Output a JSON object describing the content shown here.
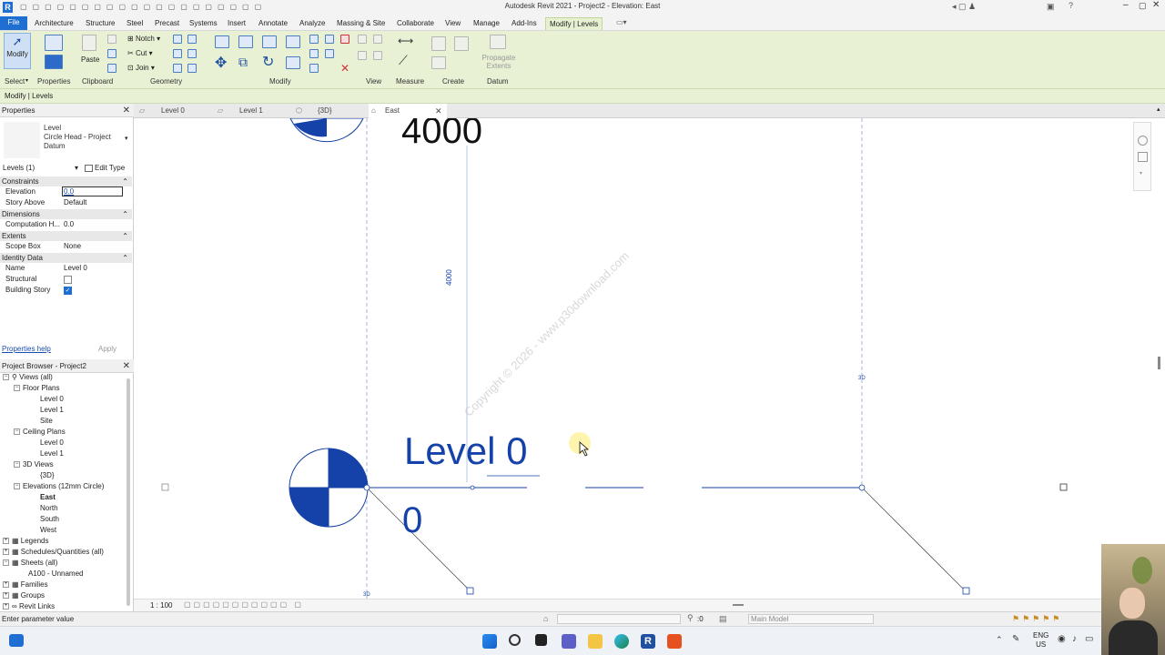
{
  "app": {
    "title": "Autodesk Revit 2021 - Project2 - Elevation: East"
  },
  "ribbon_tabs": [
    "File",
    "Architecture",
    "Structure",
    "Steel",
    "Precast",
    "Systems",
    "Insert",
    "Annotate",
    "Analyze",
    "Massing & Site",
    "Collaborate",
    "View",
    "Manage",
    "Add-Ins",
    "Modify | Levels"
  ],
  "ribbon": {
    "modify_label": "Modify",
    "paste_label": "Paste",
    "notch_label": "Notch",
    "cut_label": "Cut",
    "join_label": "Join",
    "propagate_label": "Propagate Extents",
    "groups": {
      "select": "Select",
      "properties": "Properties",
      "clipboard": "Clipboard",
      "geometry": "Geometry",
      "modify": "Modify",
      "view": "View",
      "measure": "Measure",
      "create": "Create",
      "datum": "Datum"
    }
  },
  "context_bar": "Modify | Levels",
  "properties": {
    "title": "Properties",
    "type_family": "Level",
    "type_name": "Circle Head - Project Datum",
    "selector": "Levels (1)",
    "edit_type": "Edit Type",
    "sections": {
      "constraints": "Constraints",
      "dimensions": "Dimensions",
      "extents": "Extents",
      "identity": "Identity Data"
    },
    "rows": {
      "elevation_label": "Elevation",
      "elevation_value": "0.0",
      "story_above_label": "Story Above",
      "story_above_value": "Default",
      "computation_label": "Computation H...",
      "computation_value": "0.0",
      "scope_box_label": "Scope Box",
      "scope_box_value": "None",
      "name_label": "Name",
      "name_value": "Level 0",
      "structural_label": "Structural",
      "structural_checked": false,
      "building_story_label": "Building Story",
      "building_story_checked": true
    },
    "help_link": "Properties help",
    "apply": "Apply"
  },
  "browser": {
    "title": "Project Browser - Project2",
    "views_all": "Views (all)",
    "floor_plans": "Floor Plans",
    "fp_items": [
      "Level 0",
      "Level 1",
      "Site"
    ],
    "ceiling_plans": "Ceiling Plans",
    "cp_items": [
      "Level 0",
      "Level 1"
    ],
    "views_3d": "3D Views",
    "v3d_items": [
      "{3D}"
    ],
    "elevations": "Elevations (12mm Circle)",
    "el_items": [
      "East",
      "North",
      "South",
      "West"
    ],
    "legends": "Legends",
    "schedules": "Schedules/Quantities (all)",
    "sheets": "Sheets (all)",
    "sheet_items": [
      "A100 - Unnamed"
    ],
    "families": "Families",
    "groups": "Groups",
    "revit_links": "Revit Links"
  },
  "view_tabs": [
    "Level 0",
    "Level 1",
    "{3D}",
    "East"
  ],
  "canvas": {
    "top_level_value": "4000",
    "level_name": "Level 0",
    "level_value": "0",
    "dimension": "4000",
    "watermark": "Copyright © 2026 - www.p30download.com",
    "small_3d": "3D"
  },
  "view_bar": {
    "scale": "1 : 100"
  },
  "status": {
    "prompt": "Enter parameter value",
    "selection_count": ":0",
    "model": "Main Model"
  },
  "taskbar": {
    "lang1": "ENG",
    "lang2": "US"
  },
  "colors": {
    "accent_blue": "#1f6fd2",
    "level_blue": "#1542a8",
    "ribbon_green": "#e8f1d4"
  }
}
